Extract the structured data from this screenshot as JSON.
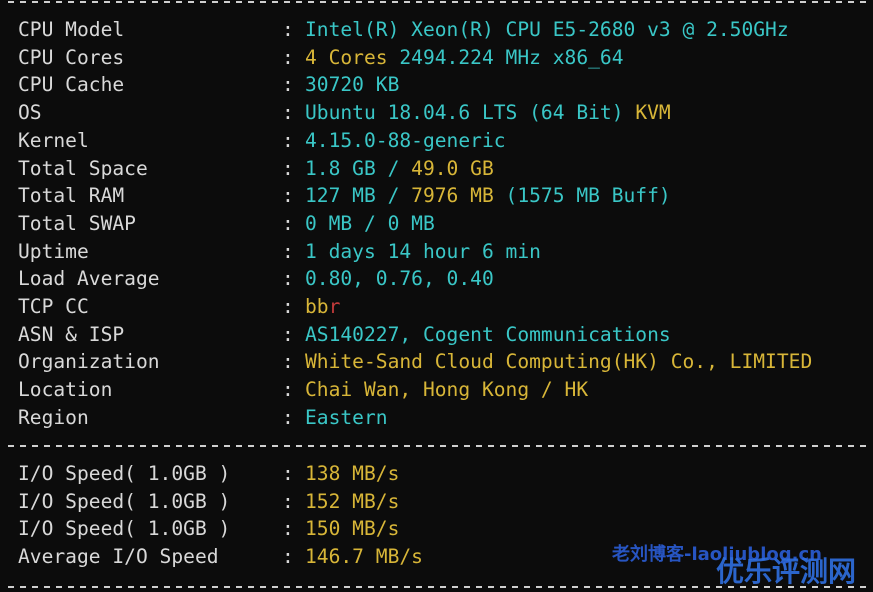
{
  "info_rows": [
    {
      "label": "CPU Model",
      "values": [
        {
          "text": "Intel(R) Xeon(R) CPU E5-2680 v3 @ 2.50GHz",
          "color": "cyan"
        }
      ]
    },
    {
      "label": "CPU Cores",
      "values": [
        {
          "text": "4 Cores ",
          "color": "yellow"
        },
        {
          "text": "2494.224 MHz x86_64",
          "color": "cyan"
        }
      ]
    },
    {
      "label": "CPU Cache",
      "values": [
        {
          "text": "30720 KB",
          "color": "cyan"
        }
      ]
    },
    {
      "label": "OS",
      "values": [
        {
          "text": "Ubuntu 18.04.6 LTS (64 Bit) ",
          "color": "cyan"
        },
        {
          "text": "KVM",
          "color": "yellow"
        }
      ]
    },
    {
      "label": "Kernel",
      "values": [
        {
          "text": "4.15.0-88-generic",
          "color": "cyan"
        }
      ]
    },
    {
      "label": "Total Space",
      "values": [
        {
          "text": "1.8 GB / ",
          "color": "cyan"
        },
        {
          "text": "49.0 GB",
          "color": "yellow"
        }
      ]
    },
    {
      "label": "Total RAM",
      "values": [
        {
          "text": "127 MB / ",
          "color": "cyan"
        },
        {
          "text": "7976 MB ",
          "color": "yellow"
        },
        {
          "text": "(1575 MB Buff)",
          "color": "cyan"
        }
      ]
    },
    {
      "label": "Total SWAP",
      "values": [
        {
          "text": "0 MB / 0 MB",
          "color": "cyan"
        }
      ]
    },
    {
      "label": "Uptime",
      "values": [
        {
          "text": "1 days 14 hour 6 min",
          "color": "cyan"
        }
      ]
    },
    {
      "label": "Load Average",
      "values": [
        {
          "text": "0.80, 0.76, 0.40",
          "color": "cyan"
        }
      ]
    },
    {
      "label": "TCP CC",
      "values": [
        {
          "text": "bb",
          "color": "yellow"
        },
        {
          "text": "r",
          "color": "red"
        }
      ]
    },
    {
      "label": "ASN & ISP",
      "values": [
        {
          "text": "AS140227, Cogent Communications",
          "color": "cyan"
        }
      ]
    },
    {
      "label": "Organization",
      "values": [
        {
          "text": "White-Sand Cloud Computing(HK) Co., LIMITED",
          "color": "yellow"
        }
      ]
    },
    {
      "label": "Location",
      "values": [
        {
          "text": "Chai Wan, Hong Kong / HK",
          "color": "yellow"
        }
      ]
    },
    {
      "label": "Region",
      "values": [
        {
          "text": "Eastern",
          "color": "cyan"
        }
      ]
    }
  ],
  "io_rows": [
    {
      "label": "I/O Speed( 1.0GB )",
      "values": [
        {
          "text": "138 MB/s",
          "color": "yellow"
        }
      ]
    },
    {
      "label": "I/O Speed( 1.0GB )",
      "values": [
        {
          "text": "152 MB/s",
          "color": "yellow"
        }
      ]
    },
    {
      "label": "I/O Speed( 1.0GB )",
      "values": [
        {
          "text": "150 MB/s",
          "color": "yellow"
        }
      ]
    },
    {
      "label": "Average I/O Speed",
      "values": [
        {
          "text": "146.7 MB/s",
          "color": "yellow"
        }
      ]
    }
  ],
  "separator": ":",
  "watermark": {
    "line1": "老刘博客-laoliublog.cn",
    "line2": "优乐评测网"
  },
  "colors": {
    "background": "#0c0c0c",
    "cyan": "#3ac7c7",
    "yellow": "#d8b638",
    "red": "#c43b3b",
    "label": "#d9d9d9"
  }
}
